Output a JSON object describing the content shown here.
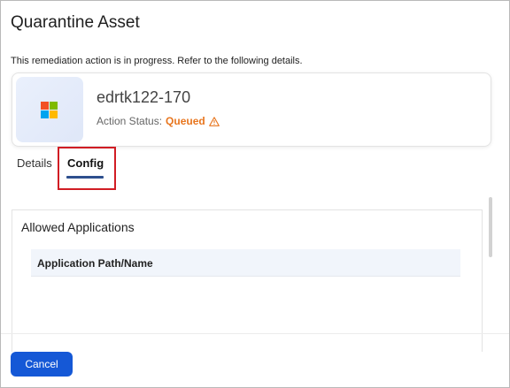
{
  "dialog": {
    "title": "Quarantine Asset",
    "description": "This remediation action is in progress. Refer to the following details."
  },
  "asset": {
    "name": "edrtk122-170",
    "os_icon": "windows-logo-icon",
    "status_label": "Action Status:",
    "status_value": "Queued",
    "status_icon": "warning-triangle-icon"
  },
  "tabs": [
    {
      "label": "Details",
      "active": false
    },
    {
      "label": "Config",
      "active": true
    }
  ],
  "panel": {
    "title": "Allowed Applications",
    "table": {
      "columns": [
        "Application Path/Name"
      ],
      "rows": []
    }
  },
  "footer": {
    "cancel_label": "Cancel"
  },
  "colors": {
    "accent": "#1558d6",
    "status": "#e8761f",
    "highlight": "#d11d24",
    "tab_underline": "#2d4f8e"
  }
}
